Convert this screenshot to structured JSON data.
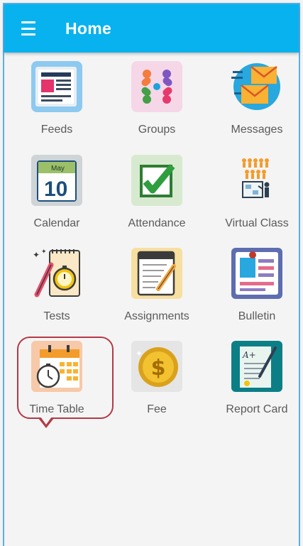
{
  "app_bar": {
    "title": "Home",
    "menu_icon": "hamburger-menu-icon",
    "background": "#07b2ee"
  },
  "tiles": [
    {
      "label": "Feeds",
      "icon": "feeds-icon"
    },
    {
      "label": "Groups",
      "icon": "groups-icon"
    },
    {
      "label": "Messages",
      "icon": "messages-icon"
    },
    {
      "label": "Calendar",
      "icon": "calendar-icon",
      "calendar_month": "May",
      "calendar_day": "10"
    },
    {
      "label": "Attendance",
      "icon": "attendance-icon"
    },
    {
      "label": "Virtual Class",
      "icon": "virtual-class-icon"
    },
    {
      "label": "Tests",
      "icon": "tests-icon"
    },
    {
      "label": "Assignments",
      "icon": "assignments-icon"
    },
    {
      "label": "Bulletin",
      "icon": "bulletin-icon"
    },
    {
      "label": "Time Table",
      "icon": "time-table-icon",
      "highlighted": true
    },
    {
      "label": "Fee",
      "icon": "fee-icon"
    },
    {
      "label": "Report Card",
      "icon": "report-card-icon",
      "report_grade": "A+"
    }
  ],
  "highlight_color": "#b33a46"
}
